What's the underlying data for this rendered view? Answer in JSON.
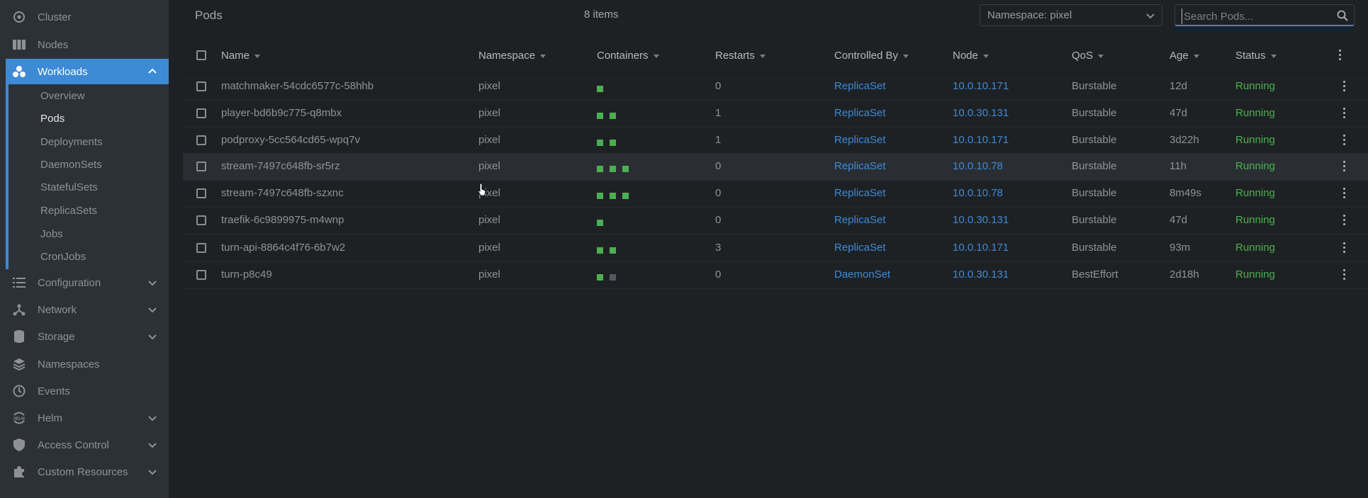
{
  "sidebar": {
    "items": [
      {
        "label": "Cluster",
        "icon": "cluster-icon"
      },
      {
        "label": "Nodes",
        "icon": "nodes-icon"
      },
      {
        "label": "Workloads",
        "icon": "workloads-icon",
        "active": true
      },
      {
        "label": "Configuration",
        "icon": "configuration-icon"
      },
      {
        "label": "Network",
        "icon": "network-icon"
      },
      {
        "label": "Storage",
        "icon": "storage-icon"
      },
      {
        "label": "Namespaces",
        "icon": "namespaces-icon"
      },
      {
        "label": "Events",
        "icon": "events-icon"
      },
      {
        "label": "Helm",
        "icon": "helm-icon"
      },
      {
        "label": "Access Control",
        "icon": "access-control-icon"
      },
      {
        "label": "Custom Resources",
        "icon": "custom-resources-icon"
      }
    ],
    "workloads_sub": [
      "Overview",
      "Pods",
      "Deployments",
      "DaemonSets",
      "StatefulSets",
      "ReplicaSets",
      "Jobs",
      "CronJobs"
    ],
    "active_sub": "Pods"
  },
  "header": {
    "title": "Pods",
    "count": "8 items",
    "namespace_select": "Namespace: pixel",
    "search_placeholder": "Search Pods..."
  },
  "table": {
    "columns": [
      "Name",
      "Namespace",
      "Containers",
      "Restarts",
      "Controlled By",
      "Node",
      "QoS",
      "Age",
      "Status"
    ],
    "rows": [
      {
        "name": "matchmaker-54cdc6577c-58hhb",
        "namespace": "pixel",
        "containers": [
          1
        ],
        "restarts": "0",
        "controlled_by": "ReplicaSet",
        "node": "10.0.10.171",
        "qos": "Burstable",
        "age": "12d",
        "status": "Running"
      },
      {
        "name": "player-bd6b9c775-q8mbx",
        "namespace": "pixel",
        "containers": [
          1,
          1
        ],
        "restarts": "1",
        "controlled_by": "ReplicaSet",
        "node": "10.0.30.131",
        "qos": "Burstable",
        "age": "47d",
        "status": "Running"
      },
      {
        "name": "podproxy-5cc564cd65-wpq7v",
        "namespace": "pixel",
        "containers": [
          1,
          1
        ],
        "restarts": "1",
        "controlled_by": "ReplicaSet",
        "node": "10.0.10.171",
        "qos": "Burstable",
        "age": "3d22h",
        "status": "Running"
      },
      {
        "name": "stream-7497c648fb-sr5rz",
        "namespace": "pixel",
        "containers": [
          1,
          1,
          1
        ],
        "restarts": "0",
        "controlled_by": "ReplicaSet",
        "node": "10.0.10.78",
        "qos": "Burstable",
        "age": "11h",
        "status": "Running"
      },
      {
        "name": "stream-7497c648fb-szxnc",
        "namespace": "pixel",
        "containers": [
          1,
          1,
          1
        ],
        "restarts": "0",
        "controlled_by": "ReplicaSet",
        "node": "10.0.10.78",
        "qos": "Burstable",
        "age": "8m49s",
        "status": "Running"
      },
      {
        "name": "traefik-6c9899975-m4wnp",
        "namespace": "pixel",
        "containers": [
          1
        ],
        "restarts": "0",
        "controlled_by": "ReplicaSet",
        "node": "10.0.30.131",
        "qos": "Burstable",
        "age": "47d",
        "status": "Running"
      },
      {
        "name": "turn-api-8864c4f76-6b7w2",
        "namespace": "pixel",
        "containers": [
          1,
          1
        ],
        "restarts": "3",
        "controlled_by": "ReplicaSet",
        "node": "10.0.10.171",
        "qos": "Burstable",
        "age": "93m",
        "status": "Running"
      },
      {
        "name": "turn-p8c49",
        "namespace": "pixel",
        "containers": [
          1,
          0
        ],
        "restarts": "0",
        "controlled_by": "DaemonSet",
        "node": "10.0.30.131",
        "qos": "BestEffort",
        "age": "2d18h",
        "status": "Running"
      }
    ]
  },
  "colors": {
    "accent": "#3d8ad6",
    "running": "#4caf50",
    "sidebar_bg": "#2c3136",
    "main_bg": "#1e2124"
  }
}
